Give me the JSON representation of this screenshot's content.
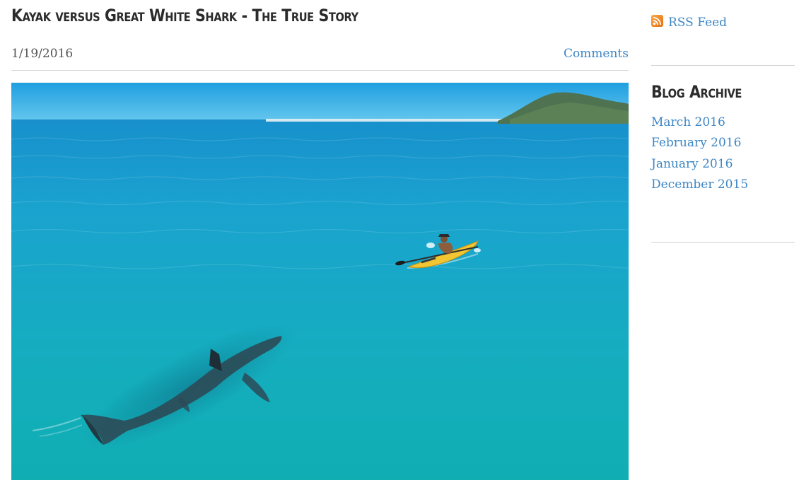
{
  "post": {
    "title": "Kayak versus Great White Shark - The True Story",
    "date": "1/19/2016",
    "comments_label": "Comments",
    "image": {
      "subject": "great-white-shark-and-kayaker-photo",
      "colors": {
        "sky_top": "#1f9fe0",
        "sky_bottom": "#62c6ee",
        "sea_far": "#1aa0d2",
        "sea_near": "#11adb6",
        "hill": "#4f7250",
        "kayak": "#f2c531"
      }
    }
  },
  "sidebar": {
    "rss_label": "RSS Feed",
    "archive_title": "Blog Archive",
    "archive_items": [
      {
        "label": "March 2016"
      },
      {
        "label": "February 2016"
      },
      {
        "label": "January 2016"
      },
      {
        "label": "December 2015"
      }
    ]
  },
  "colors": {
    "link": "#3d86c4",
    "heading": "#2b2b2b",
    "text": "#555555",
    "rss": "#f08a24"
  }
}
